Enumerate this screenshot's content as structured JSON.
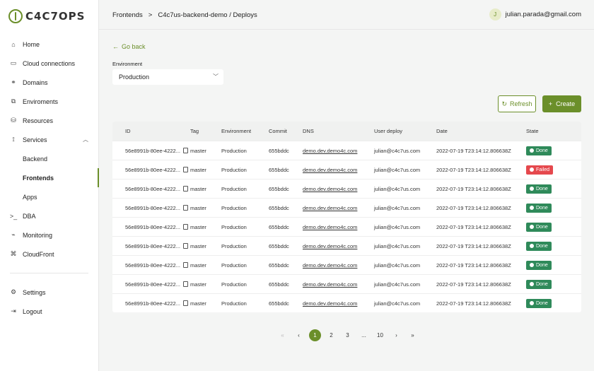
{
  "app": {
    "logo_text": "C4C7OPS",
    "accent": "#6b8f2a"
  },
  "sidebar": {
    "items": [
      {
        "label": "Home",
        "icon": "home-icon"
      },
      {
        "label": "Cloud connections",
        "icon": "cloud-icon"
      },
      {
        "label": "Domains",
        "icon": "link-icon"
      },
      {
        "label": "Enviroments",
        "icon": "layers-icon"
      },
      {
        "label": "Resources",
        "icon": "database-icon"
      },
      {
        "label": "Services",
        "icon": "services-icon"
      },
      {
        "label": "Backend"
      },
      {
        "label": "Frontends"
      },
      {
        "label": "Apps"
      },
      {
        "label": "DBA",
        "icon": "terminal-icon"
      },
      {
        "label": "Monitoring",
        "icon": "chart-icon"
      },
      {
        "label": "CloudFront",
        "icon": "grid-icon"
      }
    ],
    "bottom": [
      {
        "label": "Settings",
        "icon": "gear-icon"
      },
      {
        "label": "Logout",
        "icon": "logout-icon"
      }
    ]
  },
  "header": {
    "breadcrumb_root": "Frontends",
    "breadcrumb_sep": ">",
    "breadcrumb_current": "C4c7us-backend-demo / Deploys",
    "user_initial": "J",
    "user_email": "julian.parada@gmail.com"
  },
  "main": {
    "go_back": "Go back",
    "environment_label": "Environment",
    "environment_value": "Production",
    "refresh_label": "Refresh",
    "create_label": "Create"
  },
  "table": {
    "columns": [
      "ID",
      "Tag",
      "Environment",
      "Commit",
      "DNS",
      "User deploy",
      "Date",
      "State"
    ],
    "rows": [
      {
        "id": "56e8991b-80ee-4222...",
        "tag": "master",
        "env": "Production",
        "commit": "655bddc",
        "dns": "demo.dev.demo4c.com",
        "user": "julian@c4c7us.com",
        "date": "2022-07-19 T23:14:12.806638Z",
        "state": "Done",
        "status": "done"
      },
      {
        "id": "56e8991b-80ee-4222...",
        "tag": "master",
        "env": "Production",
        "commit": "655bddc",
        "dns": "demo.dev.demo4c.com",
        "user": "julian@c4c7us.com",
        "date": "2022-07-19 T23:14:12.806638Z",
        "state": "Failed",
        "status": "failed"
      },
      {
        "id": "56e8991b-80ee-4222...",
        "tag": "master",
        "env": "Production",
        "commit": "655bddc",
        "dns": "demo.dev.demo4c.com",
        "user": "julian@c4c7us.com",
        "date": "2022-07-19 T23:14:12.806638Z",
        "state": "Done",
        "status": "done"
      },
      {
        "id": "56e8991b-80ee-4222...",
        "tag": "master",
        "env": "Production",
        "commit": "655bddc",
        "dns": "demo.dev.demo4c.com",
        "user": "julian@c4c7us.com",
        "date": "2022-07-19 T23:14:12.806638Z",
        "state": "Done",
        "status": "done"
      },
      {
        "id": "56e8991b-80ee-4222...",
        "tag": "master",
        "env": "Production",
        "commit": "655bddc",
        "dns": "demo.dev.demo4c.com",
        "user": "julian@c4c7us.com",
        "date": "2022-07-19 T23:14:12.806638Z",
        "state": "Done",
        "status": "done"
      },
      {
        "id": "56e8991b-80ee-4222...",
        "tag": "master",
        "env": "Production",
        "commit": "655bddc",
        "dns": "demo.dev.demo4c.com",
        "user": "julian@c4c7us.com",
        "date": "2022-07-19 T23:14:12.806638Z",
        "state": "Done",
        "status": "done"
      },
      {
        "id": "56e8991b-80ee-4222...",
        "tag": "master",
        "env": "Production",
        "commit": "655bddc",
        "dns": "demo.dev.demo4c.com",
        "user": "julian@c4c7us.com",
        "date": "2022-07-19 T23:14:12.806638Z",
        "state": "Done",
        "status": "done"
      },
      {
        "id": "56e8991b-80ee-4222...",
        "tag": "master",
        "env": "Production",
        "commit": "655bddc",
        "dns": "demo.dev.demo4c.com",
        "user": "julian@c4c7us.com",
        "date": "2022-07-19 T23:14:12.806638Z",
        "state": "Done",
        "status": "done"
      },
      {
        "id": "56e8991b-80ee-4222...",
        "tag": "master",
        "env": "Production",
        "commit": "655bddc",
        "dns": "demo.dev.demo4c.com",
        "user": "julian@c4c7us.com",
        "date": "2022-07-19 T23:14:12.806638Z",
        "state": "Done",
        "status": "done"
      }
    ]
  },
  "pagination": {
    "first": "«",
    "prev": "‹",
    "pages": [
      "1",
      "2",
      "3",
      "...",
      "10"
    ],
    "current": "1",
    "next": "›",
    "last": "»"
  }
}
